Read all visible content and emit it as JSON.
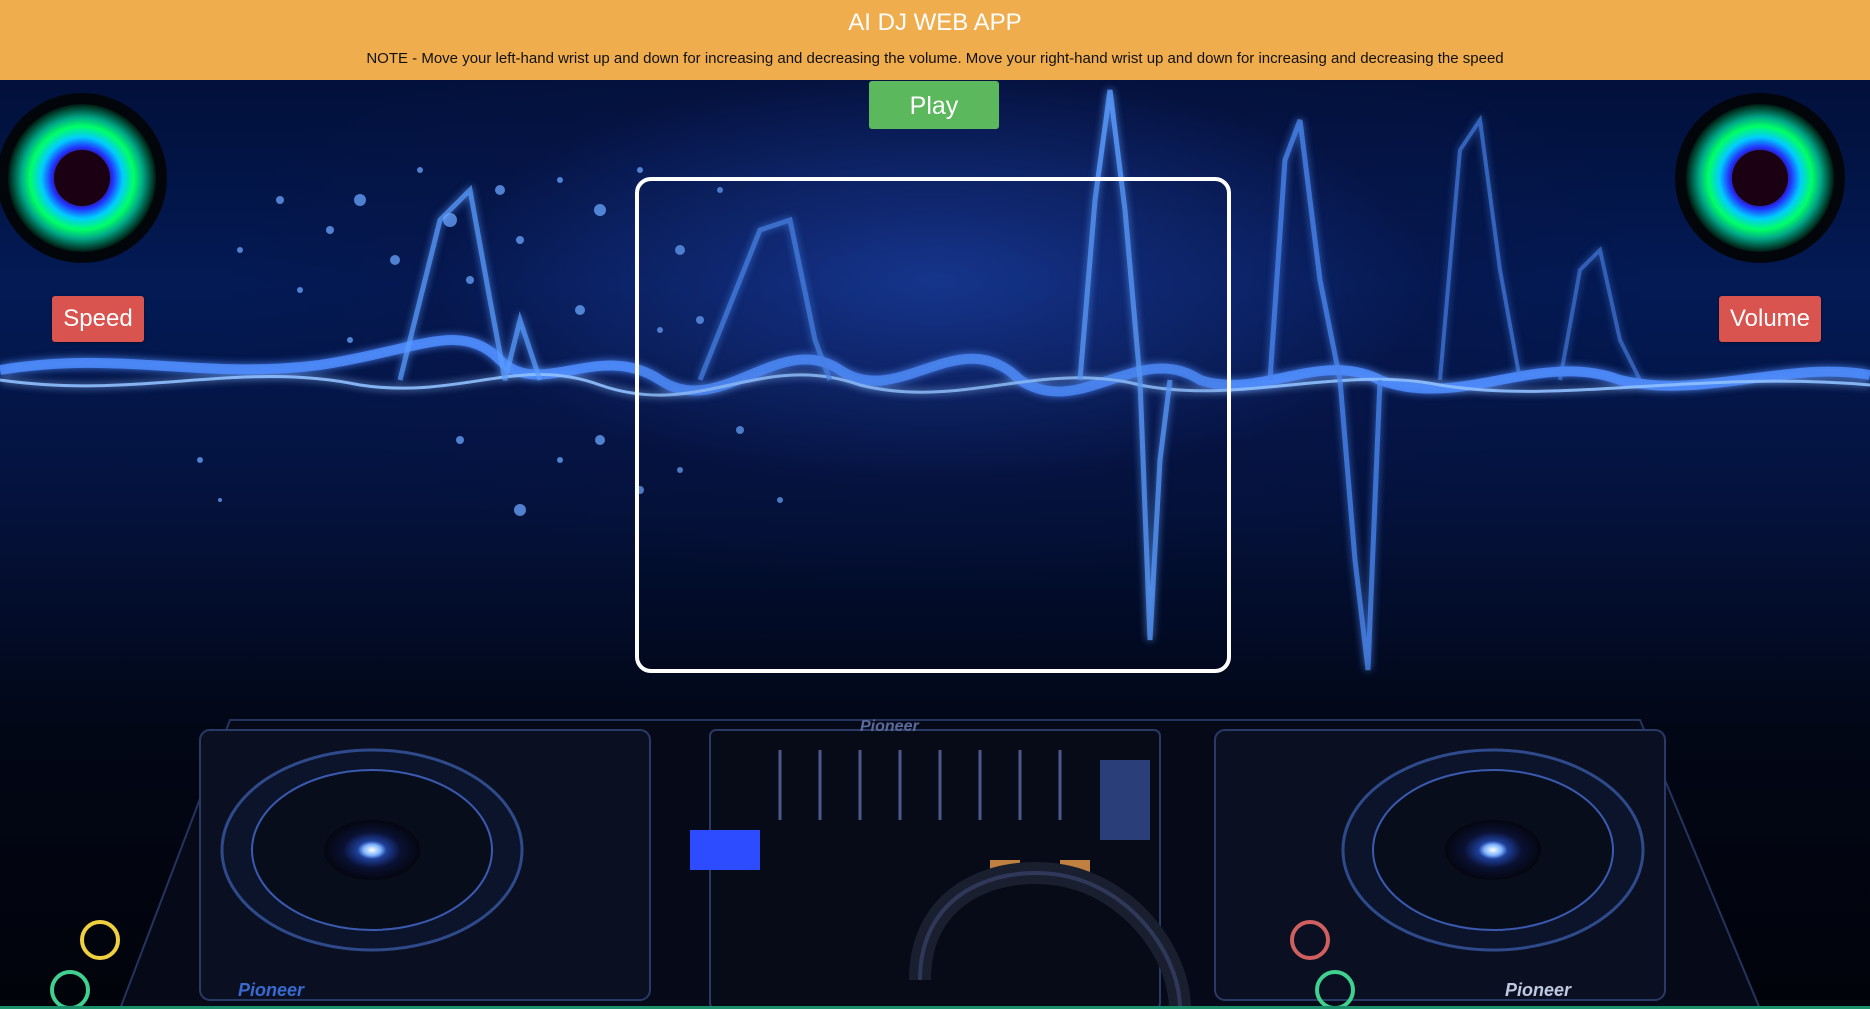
{
  "header": {
    "title": "AI DJ WEB APP",
    "note": "NOTE - Move your left-hand wrist up and down for increasing and decreasing the volume. Move your right-hand wrist up and down for increasing and decreasing the speed"
  },
  "controls": {
    "play_label": "Play",
    "speed_label": "Speed",
    "volume_label": "Volume"
  },
  "decks": {
    "left_brand": "Pioneer",
    "right_brand": "Pioneer",
    "mixer_brand": "Pioneer"
  },
  "colors": {
    "header_bg": "#f0ad4e",
    "play_bg": "#5cb85c",
    "side_btn_bg": "#d9534f",
    "frame_border": "#ffffff"
  },
  "icons": {
    "speaker_left": "speaker-icon",
    "speaker_right": "speaker-icon"
  }
}
